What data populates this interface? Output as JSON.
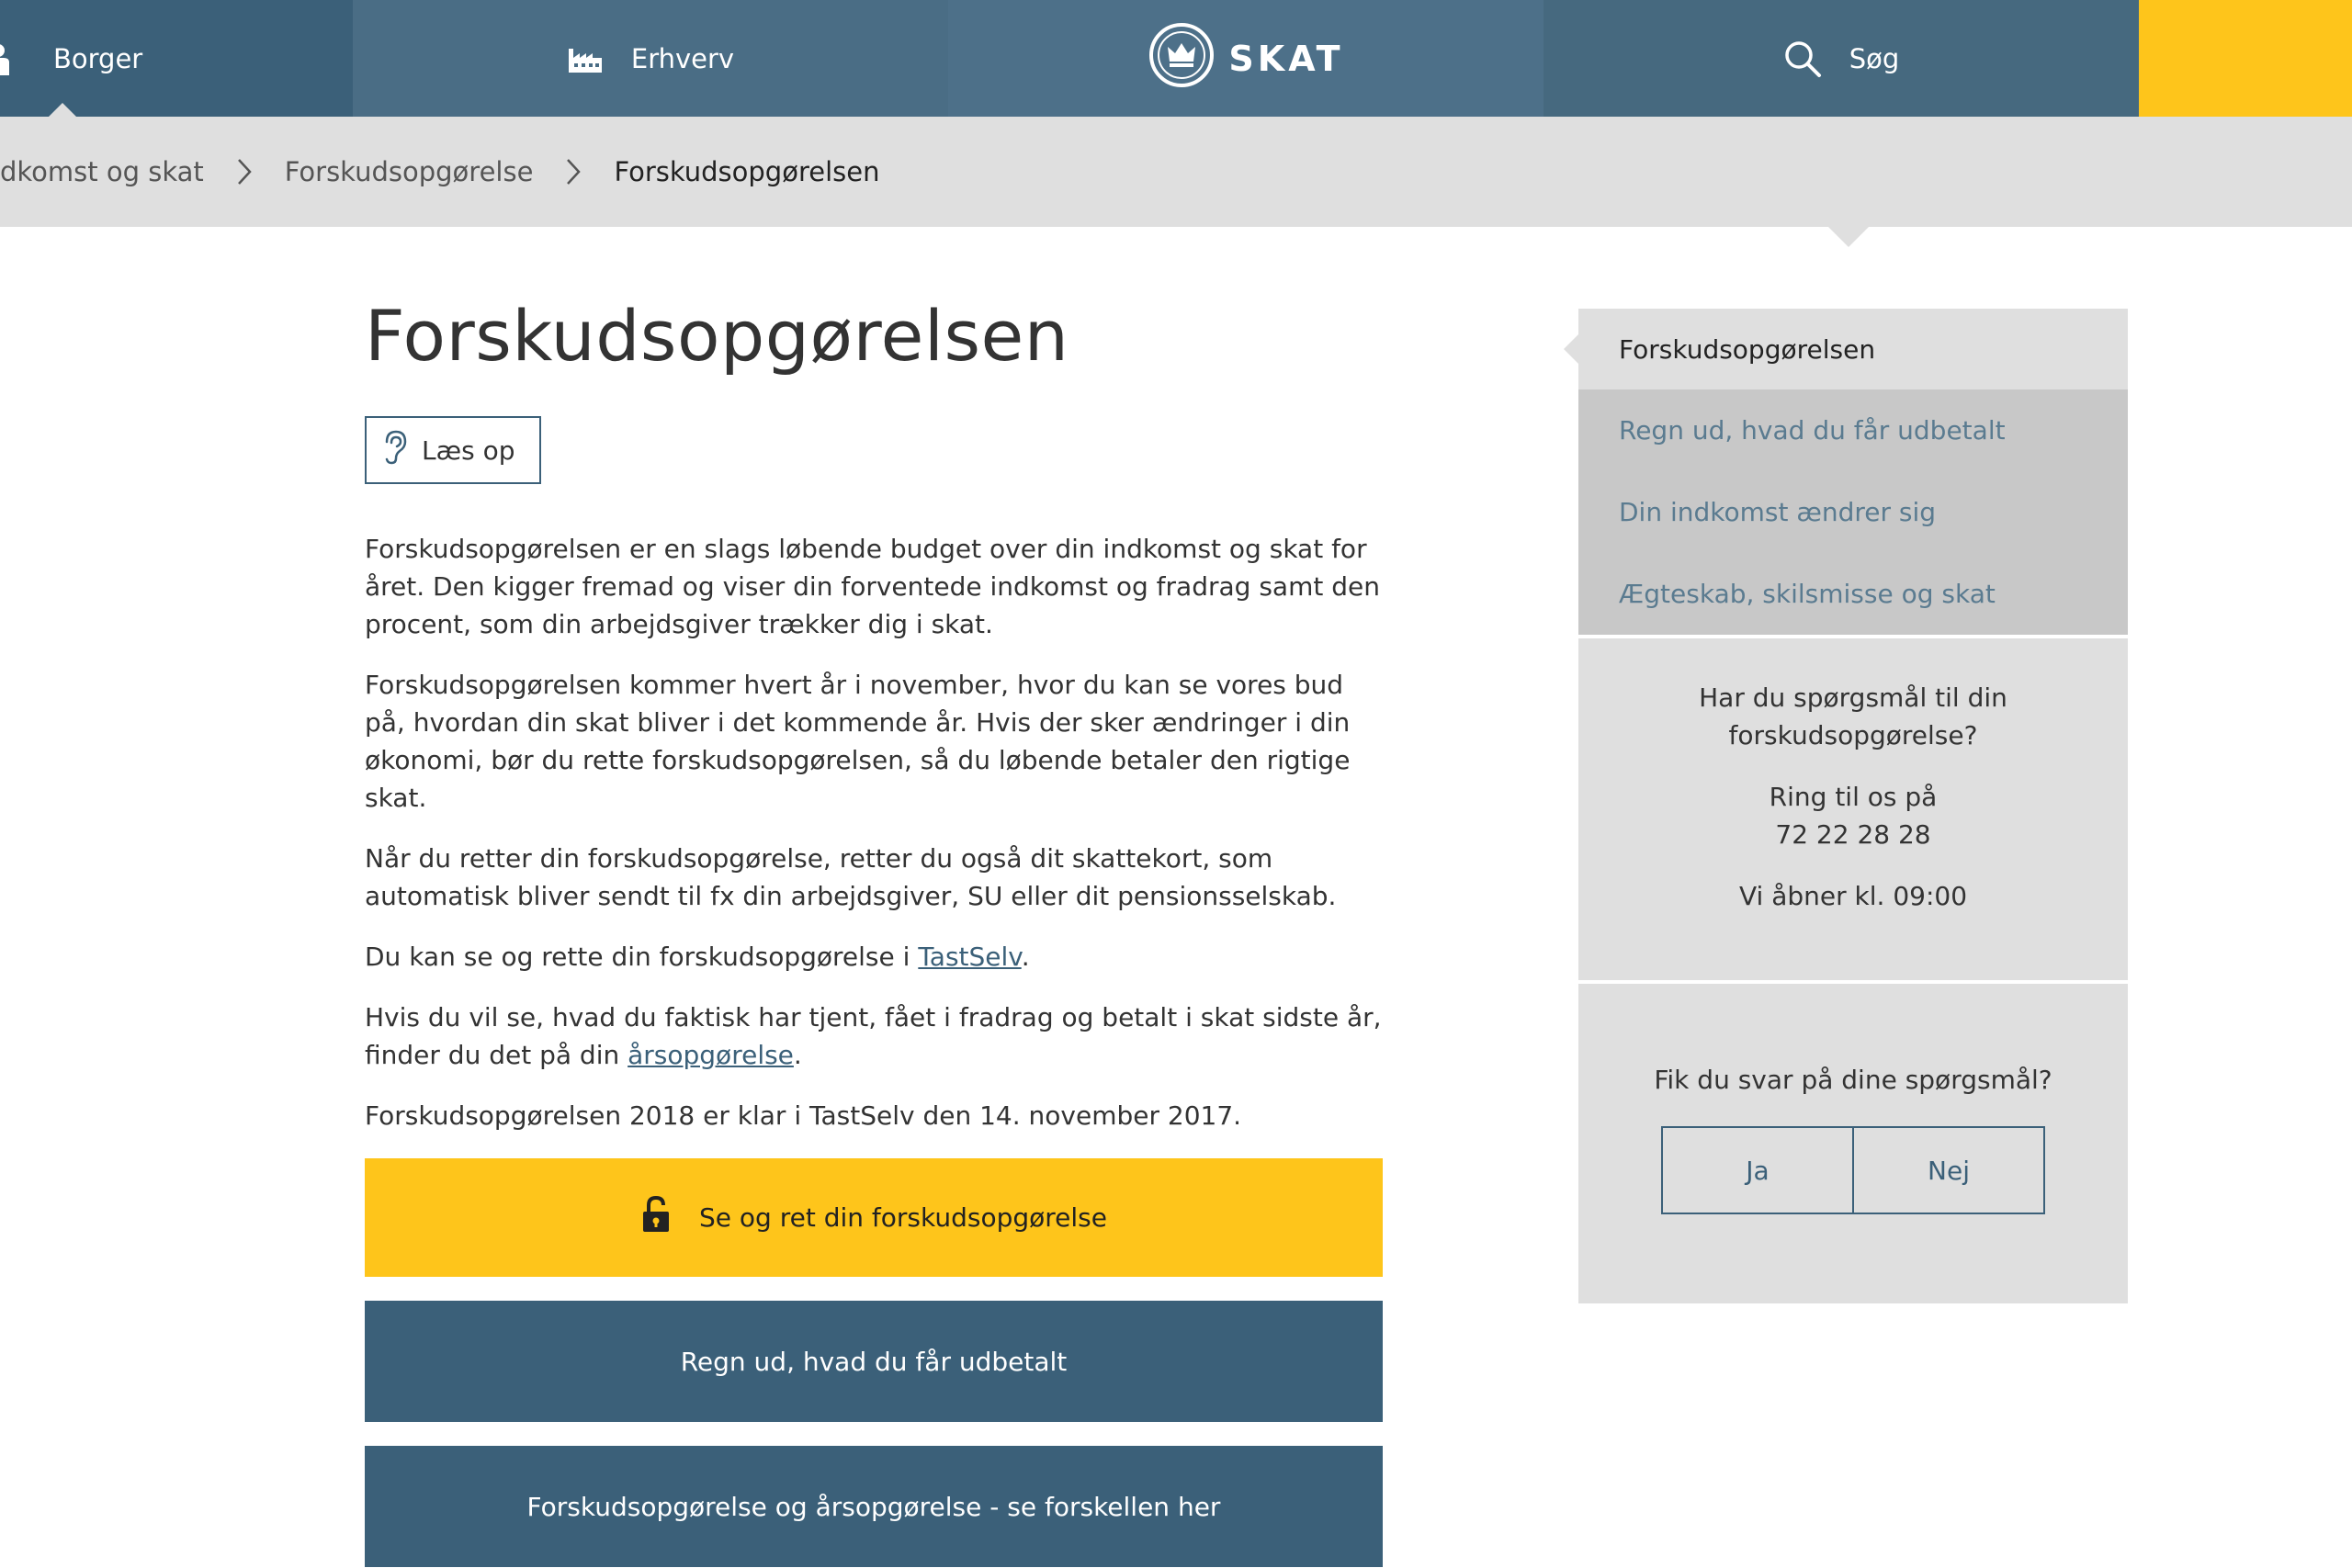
{
  "nav": {
    "borger": "Borger",
    "erhverv": "Erhverv",
    "logo": "SKAT",
    "search": "Søg"
  },
  "breadcrumb": {
    "items": [
      "dkomst og skat",
      "Forskudsopgørelse"
    ],
    "current": "Forskudsopgørelsen"
  },
  "main": {
    "title": "Forskudsopgørelsen",
    "read_aloud": "Læs op",
    "p1": "Forskudsopgørelsen er en slags løbende budget over din indkomst og skat for året. Den kigger fremad og viser din forventede indkomst og fradrag samt den procent, som din arbejdsgiver trækker dig i skat.",
    "p2": "Forskudsopgørelsen kommer hvert år i november, hvor du kan se vores bud på, hvordan din skat bliver i det kommende år. Hvis der sker ændringer i din økonomi, bør du rette forskudsopgørelsen, så du løbende betaler den rigtige skat.",
    "p3": "Når du retter din forskudsopgørelse, retter du også dit skattekort, som automatisk bliver sendt til fx din arbejdsgiver, SU eller dit pensionsselskab.",
    "p4_before": "Du kan se og rette din forskudsopgørelse i ",
    "p4_link": "TastSelv",
    "p4_after": ".",
    "p5_before": "Hvis du vil se, hvad du faktisk har tjent, fået i fradrag og betalt i skat sidste år, finder du det på din ",
    "p5_link": "årsopgørelse",
    "p5_after": ".",
    "p6": "Forskudsopgørelsen 2018 er klar i TastSelv den 14. november 2017.",
    "btn_primary": "Se og ret din forskudsopgørelse",
    "btn_calc": "Regn ud, hvad du får udbetalt",
    "btn_compare": "Forskudsopgørelse og årsopgørelse - se forskellen her"
  },
  "side": {
    "active": "Forskudsopgørelsen",
    "items": [
      "Regn ud, hvad du får udbetalt",
      "Din indkomst ændrer sig",
      "Ægteskab, skilsmisse og skat"
    ],
    "contact_q1": "Har du spørgsmål til din",
    "contact_q2": "forskudsopgørelse?",
    "contact_call": "Ring til os på",
    "contact_phone": "72 22 28 28",
    "contact_open": "Vi åbner kl. 09:00",
    "feedback_q": "Fik du svar på dine spørgsmål?",
    "yes": "Ja",
    "no": "Nej"
  },
  "colors": {
    "nav_blue": "#3b6079",
    "accent_yellow": "#fec51b",
    "breadcrumb_grey": "#dfdfdf"
  }
}
